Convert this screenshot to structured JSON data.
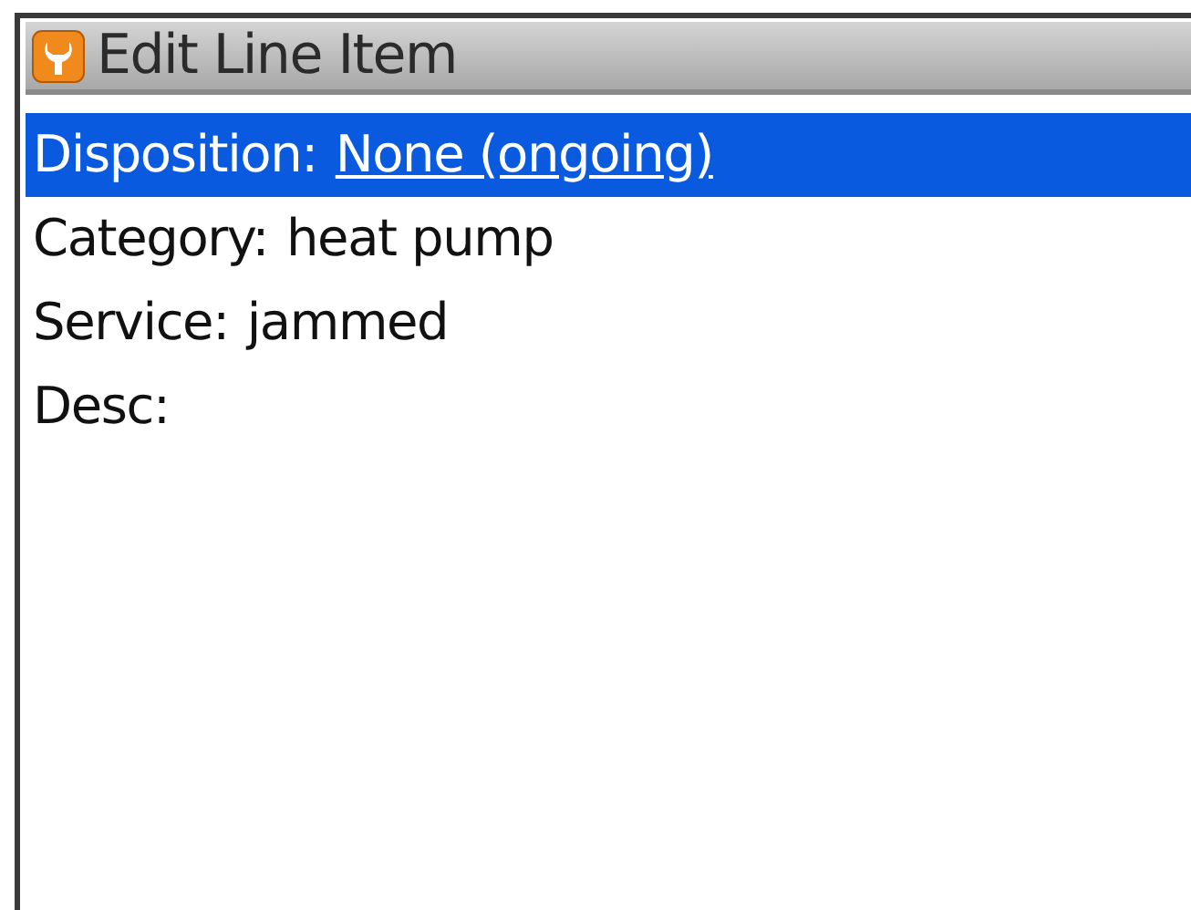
{
  "window": {
    "title": "Edit Line Item"
  },
  "fields": [
    {
      "label": "Disposition:",
      "value": "None (ongoing)",
      "underlined": true,
      "selected": true
    },
    {
      "label": "Category:",
      "value": "heat pump",
      "underlined": false,
      "selected": false
    },
    {
      "label": "Service:",
      "value": "jammed",
      "underlined": false,
      "selected": false
    },
    {
      "label": "Desc:",
      "selected": false
    }
  ]
}
